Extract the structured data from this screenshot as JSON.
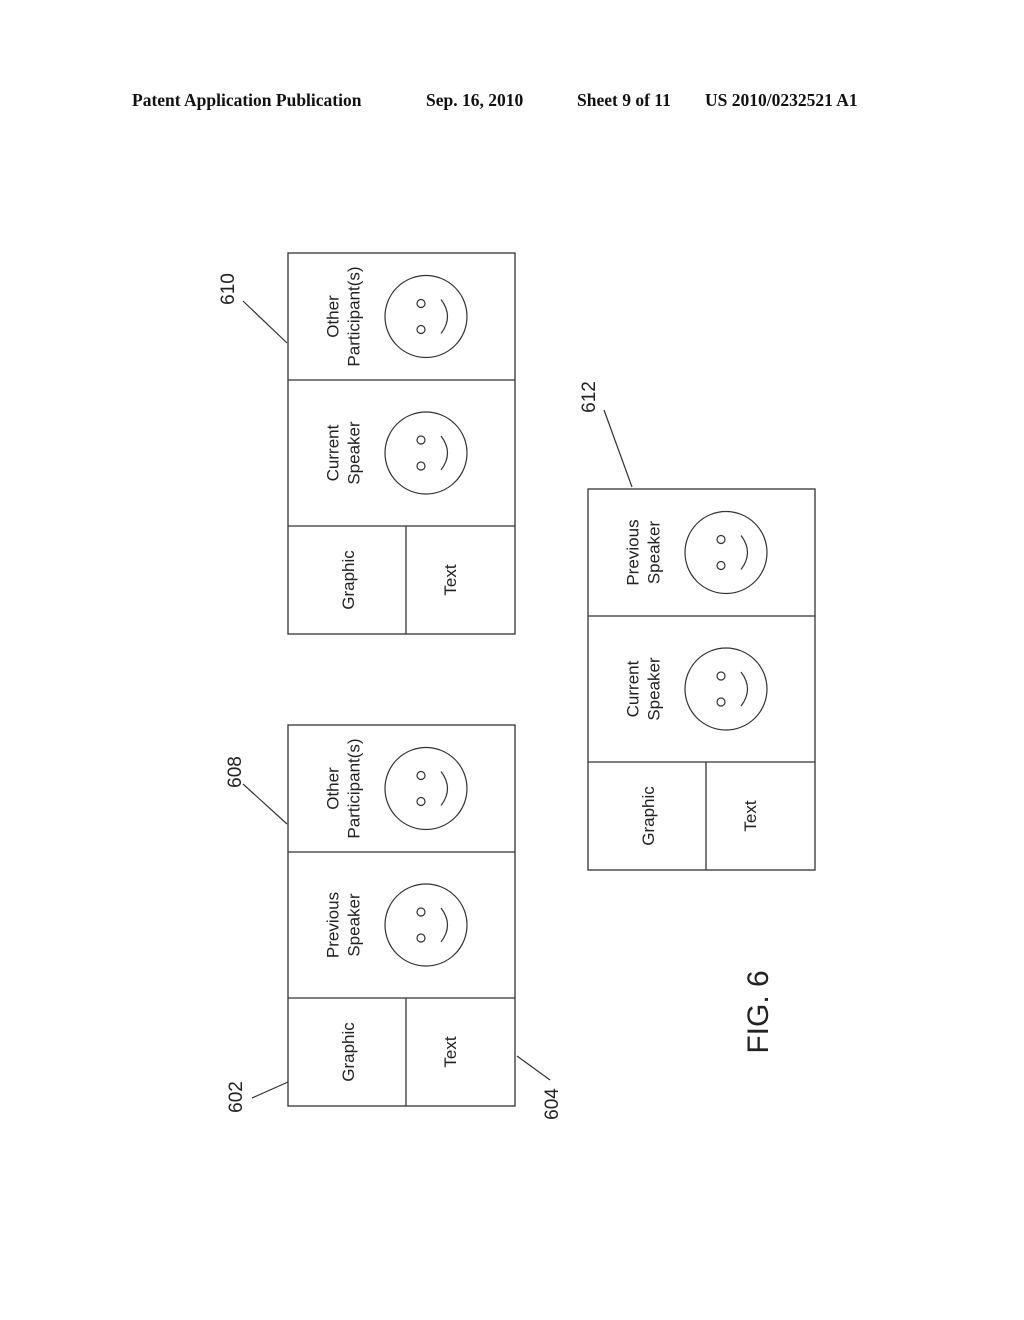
{
  "header": {
    "publication": "Patent Application Publication",
    "date": "Sep. 16, 2010",
    "sheet": "Sheet 9 of 11",
    "number": "US 2010/0232521 A1"
  },
  "figure_label": "FIG. 6",
  "layouts": [
    {
      "id": "layout-a",
      "panels": {
        "top": "Other Participant(s)",
        "middle": "Previous Speaker",
        "bottom_left": "Graphic",
        "bottom_right": "Text"
      },
      "refs": [
        "602",
        "604",
        "608"
      ]
    },
    {
      "id": "layout-b",
      "panels": {
        "top": "Other Participant(s)",
        "middle": "Current Speaker",
        "bottom_left": "Graphic",
        "bottom_right": "Text"
      },
      "refs": [
        "610"
      ]
    },
    {
      "id": "layout-c",
      "panels": {
        "top": "Previous Speaker",
        "middle": "Current Speaker",
        "bottom_left": "Graphic",
        "bottom_right": "Text"
      },
      "refs": [
        "612"
      ]
    }
  ]
}
